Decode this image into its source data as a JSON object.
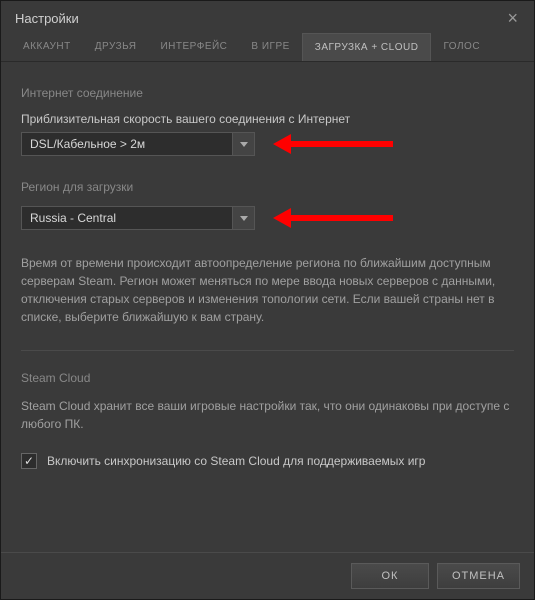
{
  "window": {
    "title": "Настройки"
  },
  "tabs": {
    "account": "АККАУНТ",
    "friends": "ДРУЗЬЯ",
    "interface": "ИНТЕРФЕЙС",
    "ingame": "В ИГРЕ",
    "downloads": "ЗАГРУЗКА + CLOUD",
    "voice": "ГОЛОС"
  },
  "internet": {
    "section_label": "Интернет соединение",
    "speed_label": "Приблизительная скорость вашего соединения с Интернет",
    "speed_value": "DSL/Кабельное > 2м"
  },
  "region": {
    "label": "Регион для загрузки",
    "value": "Russia - Central",
    "description": "Время от времени происходит автоопределение региона по ближайшим доступным серверам Steam. Регион может меняться по мере ввода новых серверов с данными, отключения старых серверов и изменения топологии сети. Если вашей страны нет в списке, выберите ближайшую к вам страну."
  },
  "cloud": {
    "title": "Steam Cloud",
    "description": "Steam Cloud хранит все ваши игровые настройки так, что они одинаковы при доступе с любого ПК.",
    "checkbox_label": "Включить синхронизацию со Steam Cloud для поддерживаемых игр",
    "checked": true
  },
  "footer": {
    "ok": "ОК",
    "cancel": "ОТМЕНА"
  }
}
